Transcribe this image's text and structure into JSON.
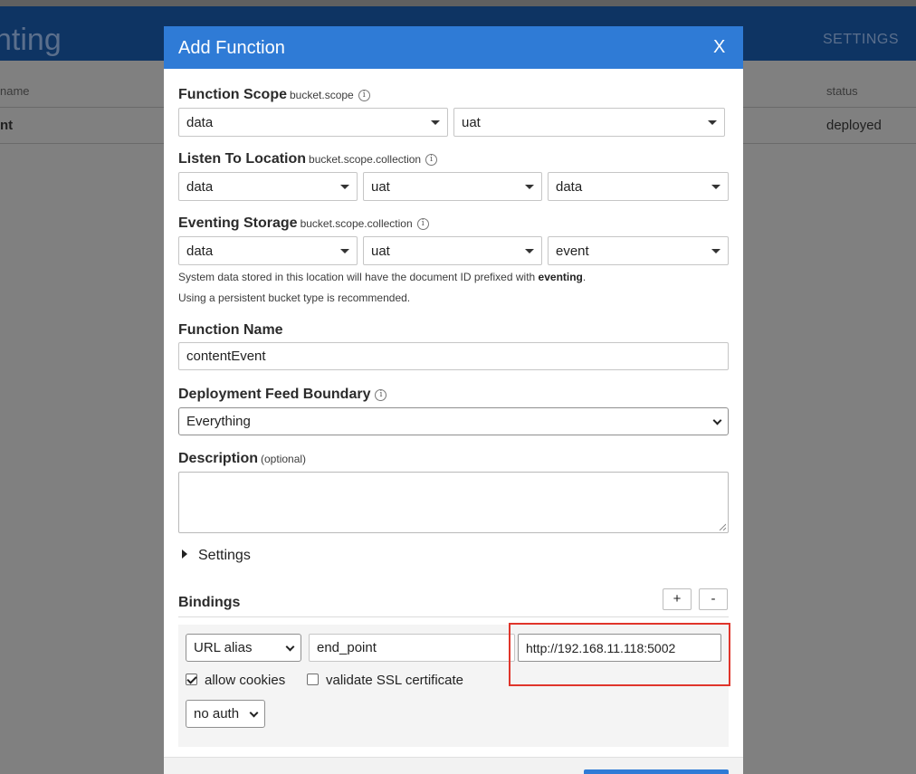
{
  "background": {
    "title": "nting",
    "settings_link": "SETTINGS",
    "columns": {
      "name": "name",
      "status": "status"
    },
    "row": {
      "name": "nt",
      "status": "deployed"
    }
  },
  "modal": {
    "title": "Add Function",
    "close_label": "X",
    "function_scope": {
      "label": "Function Scope",
      "sublabel": "bucket.scope",
      "bucket": "data",
      "scope": "uat"
    },
    "listen_to_location": {
      "label": "Listen To Location",
      "sublabel": "bucket.scope.collection",
      "bucket": "data",
      "scope": "uat",
      "collection": "data"
    },
    "eventing_storage": {
      "label": "Eventing Storage",
      "sublabel": "bucket.scope.collection",
      "bucket": "data",
      "scope": "uat",
      "collection": "event",
      "hint_prefix": "System data stored in this location will have the document ID prefixed with",
      "hint_bold": "eventing",
      "hint_suffix": ".",
      "hint2": "Using a persistent bucket type is recommended."
    },
    "function_name": {
      "label": "Function Name",
      "value": "contentEvent"
    },
    "deployment_feed_boundary": {
      "label": "Deployment Feed Boundary",
      "value": "Everything"
    },
    "description": {
      "label": "Description",
      "sublabel": "(optional)",
      "value": ""
    },
    "settings_toggle": "Settings",
    "bindings": {
      "label": "Bindings",
      "add_label": "+",
      "remove_label": "-",
      "type": "URL alias",
      "alias": "end_point",
      "url": "http://192.168.11.118:5002",
      "allow_cookies": {
        "label": "allow cookies",
        "checked": true
      },
      "validate_ssl": {
        "label": "validate SSL certificate",
        "checked": false
      },
      "auth": "no auth"
    }
  },
  "colors": {
    "accent": "#2f7bd6",
    "header_bg": "#0e3463",
    "highlight": "#e0352b"
  }
}
